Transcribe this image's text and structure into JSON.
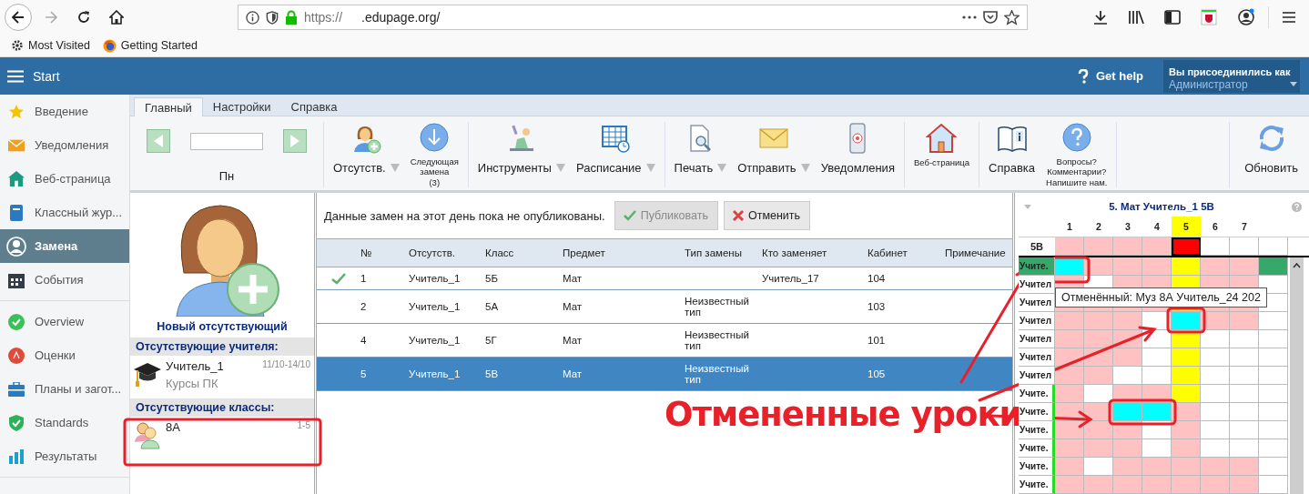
{
  "browser": {
    "url_scheme": "https://",
    "url_host": ".edupage.org/",
    "forward_disabled": true,
    "bookmarks": [
      "Most Visited",
      "Getting Started"
    ]
  },
  "header": {
    "title": "Start",
    "help": "Get help",
    "account": {
      "label": "Вы присоединились как",
      "role": "Администратор"
    }
  },
  "sidebar": {
    "sections": [
      {
        "items": [
          {
            "label": "Введение",
            "selected": false
          },
          {
            "label": "Уведомления",
            "selected": false
          },
          {
            "label": "Веб-страница",
            "selected": false
          },
          {
            "label": "Классный жур...",
            "selected": false
          },
          {
            "label": "Замена",
            "selected": true
          },
          {
            "label": "События",
            "selected": false
          }
        ]
      },
      {
        "items": [
          {
            "label": "Overview",
            "selected": false
          },
          {
            "label": "Оценки",
            "selected": false
          },
          {
            "label": "Планы и загот...",
            "selected": false
          },
          {
            "label": "Standards",
            "selected": false
          },
          {
            "label": "Результаты",
            "selected": false
          }
        ]
      }
    ]
  },
  "tabs": [
    {
      "label": "Главный",
      "selected": true
    },
    {
      "label": "Настройки",
      "selected": false
    },
    {
      "label": "Справка",
      "selected": false
    }
  ],
  "ribbon": {
    "day": "Пн",
    "groups": [
      [
        {
          "lines": [
            "Отсутств."
          ],
          "kind": "large",
          "dropdown": true
        },
        {
          "lines": [
            "Следующая",
            "замена",
            "(3)"
          ],
          "kind": "small",
          "dropdown": false
        }
      ],
      [
        {
          "lines": [
            "Инструменты"
          ],
          "kind": "large",
          "dropdown": true
        },
        {
          "lines": [
            "Расписание"
          ],
          "kind": "large",
          "dropdown": true
        }
      ],
      [
        {
          "lines": [
            "Печать"
          ],
          "kind": "large",
          "dropdown": true
        },
        {
          "lines": [
            "Отправить"
          ],
          "kind": "large",
          "dropdown": true
        },
        {
          "lines": [
            "Уведомления"
          ],
          "kind": "large",
          "dropdown": false
        }
      ],
      [
        {
          "lines": [
            "Веб-страница"
          ],
          "kind": "small",
          "dropdown": false
        }
      ],
      [
        {
          "lines": [
            "Справка"
          ],
          "kind": "large",
          "dropdown": false
        },
        {
          "lines": [
            "Вопросы?",
            "Комментарии?",
            "Напишите нам."
          ],
          "kind": "small",
          "dropdown": false
        }
      ],
      [
        {
          "lines": [
            "Обновить"
          ],
          "kind": "large",
          "dropdown": false
        }
      ]
    ]
  },
  "absences": {
    "new_absent": "Новый отсутствующий",
    "teachers_title": "Отсутствующие учителя:",
    "teachers": [
      {
        "name": "Учитель_1",
        "dates": "11/10-14/10",
        "reason": "Курсы ПК"
      }
    ],
    "classes_title": "Отсутствующие классы:",
    "classes": [
      {
        "name": "8А",
        "periods": "1-5"
      }
    ]
  },
  "substitutions": {
    "notice": "Данные замен на этот день пока не опубликованы.",
    "buttons": [
      {
        "label": "Публиковать",
        "kind": "publish",
        "disabled": true
      },
      {
        "label": "Отменить",
        "kind": "cancel",
        "disabled": false
      }
    ],
    "columns": [
      "№",
      "Отсутств.",
      "Класс",
      "Предмет",
      "Тип замены",
      "Кто заменяет",
      "Кабинет",
      "Примечание"
    ],
    "rows": [
      {
        "confirmed": true,
        "selected": false,
        "no": "1",
        "absent": "Учитель_1",
        "class": "5Б",
        "subject": "Мат",
        "substitute": "Учитель_17",
        "room": "104"
      },
      {
        "confirmed": false,
        "selected": false,
        "no": "2",
        "absent": "Учитель_1",
        "class": "5А",
        "subject": "Мат",
        "type": "Неизвестный тип",
        "room": "103"
      },
      {
        "confirmed": false,
        "selected": false,
        "no": "4",
        "absent": "Учитель_1",
        "class": "5Г",
        "subject": "Мат",
        "type": "Неизвестный тип",
        "room": "101"
      },
      {
        "confirmed": false,
        "selected": true,
        "no": "5",
        "absent": "Учитель_1",
        "class": "5В",
        "subject": "Мат",
        "type": "Неизвестный тип",
        "room": "105"
      }
    ]
  },
  "timetable": {
    "title": "5. Мат Учитель_1 5В",
    "periods": [
      "1",
      "2",
      "3",
      "4",
      "5",
      "6",
      "7"
    ],
    "class_row": {
      "name": "5В",
      "cells": [
        {
          "kind": "busy"
        },
        {
          "kind": "busy"
        },
        {
          "kind": "busy"
        },
        {
          "kind": "busy"
        },
        {
          "kind": "current"
        },
        {
          "kind": "free"
        },
        {
          "kind": "free"
        }
      ]
    },
    "rows": [
      {
        "name": "Учите.",
        "selected": true,
        "marked": false,
        "cells": [
          {
            "kind": "cancelled"
          },
          {
            "kind": "busy"
          },
          {
            "kind": "busy"
          },
          {
            "kind": "busy"
          },
          {
            "kind": "highlight"
          },
          {
            "kind": "busy"
          },
          {
            "kind": "busy"
          }
        ]
      },
      {
        "name": "Учител",
        "selected": false,
        "marked": false,
        "cells": [
          {
            "kind": "busy"
          },
          {
            "kind": "free"
          },
          {
            "kind": "busy"
          },
          {
            "kind": "busy"
          },
          {
            "kind": "highlight"
          },
          {
            "kind": "busy"
          },
          {
            "kind": "busy"
          }
        ]
      },
      {
        "name": "Учител",
        "selected": false,
        "marked": false,
        "cells": [
          {
            "kind": "busy"
          },
          {
            "kind": "busy"
          },
          {
            "kind": "busy"
          },
          {
            "kind": "busy"
          },
          {
            "kind": "highlight"
          },
          {
            "kind": "busy"
          },
          {
            "kind": "busy"
          }
        ]
      },
      {
        "name": "Учител",
        "selected": false,
        "marked": false,
        "cells": [
          {
            "kind": "busy"
          },
          {
            "kind": "busy"
          },
          {
            "kind": "busy"
          },
          {
            "kind": "free"
          },
          {
            "kind": "cancelled"
          },
          {
            "kind": "busy"
          },
          {
            "kind": "busy"
          }
        ]
      },
      {
        "name": "Учител",
        "selected": false,
        "marked": false,
        "cells": [
          {
            "kind": "busy"
          },
          {
            "kind": "busy"
          },
          {
            "kind": "busy"
          },
          {
            "kind": "free"
          },
          {
            "kind": "highlight"
          },
          {
            "kind": "free"
          },
          {
            "kind": "free"
          }
        ]
      },
      {
        "name": "Учител",
        "selected": false,
        "marked": false,
        "cells": [
          {
            "kind": "busy"
          },
          {
            "kind": "busy"
          },
          {
            "kind": "busy"
          },
          {
            "kind": "free"
          },
          {
            "kind": "highlight"
          },
          {
            "kind": "free"
          },
          {
            "kind": "free"
          }
        ]
      },
      {
        "name": "Учител",
        "selected": false,
        "marked": false,
        "cells": [
          {
            "kind": "busy"
          },
          {
            "kind": "busy"
          },
          {
            "kind": "free"
          },
          {
            "kind": "free"
          },
          {
            "kind": "highlight"
          },
          {
            "kind": "free"
          },
          {
            "kind": "free"
          }
        ]
      },
      {
        "name": "Учите.",
        "selected": false,
        "marked": true,
        "cells": [
          {
            "kind": "busy"
          },
          {
            "kind": "free"
          },
          {
            "kind": "busy"
          },
          {
            "kind": "busy"
          },
          {
            "kind": "highlight"
          },
          {
            "kind": "free"
          },
          {
            "kind": "free"
          }
        ]
      },
      {
        "name": "Учите.",
        "selected": false,
        "marked": true,
        "cells": [
          {
            "kind": "busy"
          },
          {
            "kind": "busy"
          },
          {
            "kind": "cancelled"
          },
          {
            "kind": "cancelled"
          },
          {
            "kind": "busy"
          },
          {
            "kind": "free"
          },
          {
            "kind": "free"
          }
        ]
      },
      {
        "name": "Учите.",
        "selected": false,
        "marked": true,
        "cells": [
          {
            "kind": "busy"
          },
          {
            "kind": "busy"
          },
          {
            "kind": "busy"
          },
          {
            "kind": "free"
          },
          {
            "kind": "busy"
          },
          {
            "kind": "free"
          },
          {
            "kind": "free"
          }
        ]
      },
      {
        "name": "Учите.",
        "selected": false,
        "marked": true,
        "cells": [
          {
            "kind": "busy"
          },
          {
            "kind": "busy"
          },
          {
            "kind": "busy"
          },
          {
            "kind": "free"
          },
          {
            "kind": "busy"
          },
          {
            "kind": "free"
          },
          {
            "kind": "free"
          }
        ]
      },
      {
        "name": "Учите.",
        "selected": false,
        "marked": true,
        "cells": [
          {
            "kind": "busy"
          },
          {
            "kind": "free"
          },
          {
            "kind": "busy"
          },
          {
            "kind": "busy"
          },
          {
            "kind": "busy"
          },
          {
            "kind": "busy"
          },
          {
            "kind": "busy"
          }
        ]
      },
      {
        "name": "Учите.",
        "selected": false,
        "marked": true,
        "cells": [
          {
            "kind": "busy"
          },
          {
            "kind": "busy"
          },
          {
            "kind": "busy"
          },
          {
            "kind": "busy"
          },
          {
            "kind": "busy"
          },
          {
            "kind": "busy"
          },
          {
            "kind": "busy"
          }
        ]
      }
    ],
    "tooltip": "Отменённый: Муз 8А Учитель_24 202"
  },
  "annotation": {
    "text": "Отмененные уроки"
  }
}
